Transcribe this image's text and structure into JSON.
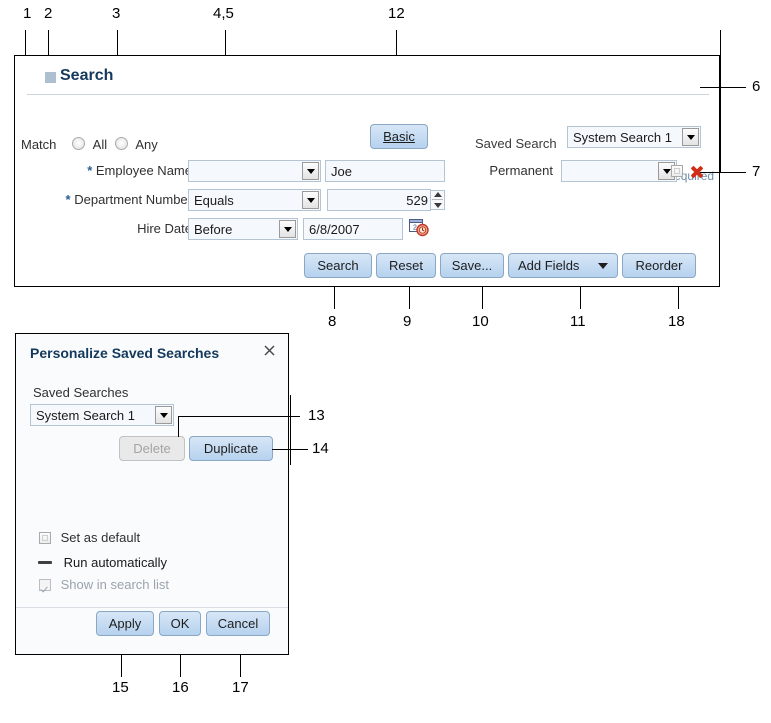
{
  "search_panel": {
    "title": "Search",
    "disclosure_icon": "triangle-collapse-icon",
    "mode_button": "Basic",
    "mode_button_mnemonic": "B",
    "saved_search_label": "Saved Search",
    "saved_search_value": "System Search 1",
    "required_marker": "*",
    "required_text": "Required",
    "match_label": "Match",
    "match_options": [
      "All",
      "Any"
    ],
    "fields": [
      {
        "required": true,
        "label": "Employee Name",
        "operator": "",
        "value": "Joe",
        "control": "lov"
      },
      {
        "required": true,
        "label": "Department Number",
        "operator": "Equals",
        "value": "529",
        "control": "spinner"
      },
      {
        "required": false,
        "label": "Hire Date",
        "operator": "Before",
        "value": "6/8/2007",
        "control": "date",
        "icon": "calendar-clock-icon"
      }
    ],
    "extra_field": {
      "label": "Permanent",
      "operator": "",
      "checkbox_checked": false,
      "delete_icon": "delete-x-icon"
    },
    "buttons": [
      {
        "label": "Search",
        "kind": "primary"
      },
      {
        "label": "Reset",
        "kind": "primary"
      },
      {
        "label": "Save...",
        "kind": "primary"
      },
      {
        "label": "Add Fields",
        "kind": "menu"
      },
      {
        "label": "Reorder",
        "kind": "primary"
      }
    ]
  },
  "dialog": {
    "title": "Personalize Saved Searches",
    "close_icon": "close-icon",
    "saved_searches_label": "Saved Searches",
    "saved_searches_value": "System Search 1",
    "delete_button": "Delete",
    "duplicate_button": "Duplicate",
    "checkboxes": [
      {
        "label": "Set as default",
        "state": "unchecked"
      },
      {
        "label": "Run automatically",
        "state": "mixed"
      },
      {
        "label": "Show in search list",
        "state": "checked-disabled"
      }
    ],
    "footer_buttons": [
      "Apply",
      "OK",
      "Cancel"
    ]
  },
  "callouts": {
    "c1": "1",
    "c2": "2",
    "c3": "3",
    "c45": "4,5",
    "c12": "12",
    "c6": "6",
    "c7": "7",
    "c8": "8",
    "c9": "9",
    "c10": "10",
    "c11": "11",
    "c18": "18",
    "c13": "13",
    "c14": "14",
    "c15": "15",
    "c16": "16",
    "c17": "17"
  },
  "colors": {
    "title_blue": "#14395c",
    "button_blue": "#b6d2ef",
    "required_blue": "#6f8ca8",
    "delete_red": "#cf2f16"
  }
}
